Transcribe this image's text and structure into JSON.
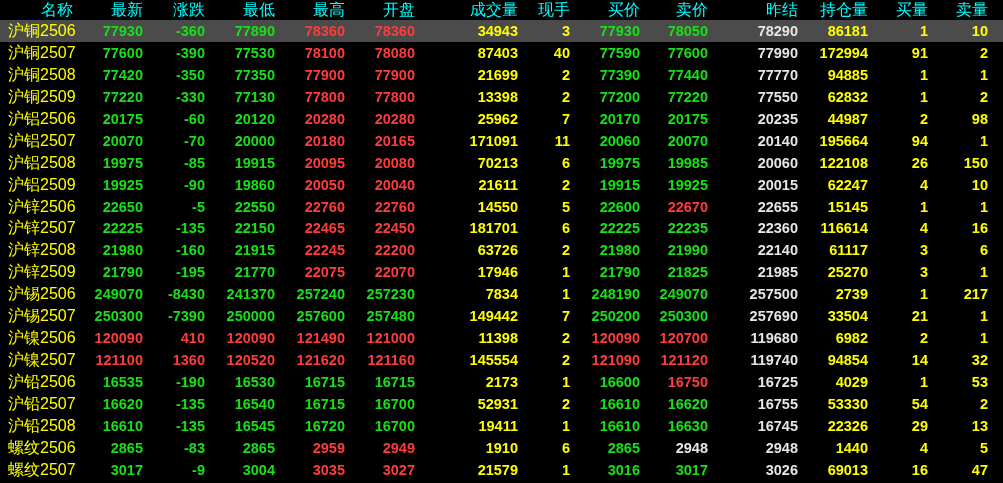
{
  "columns": [
    {
      "label": "名称",
      "kind": "name"
    },
    {
      "label": "最新",
      "kind": "price"
    },
    {
      "label": "涨跌",
      "kind": "price"
    },
    {
      "label": "最低",
      "kind": "price"
    },
    {
      "label": "最高",
      "kind": "price"
    },
    {
      "label": "开盘",
      "kind": "price"
    },
    {
      "label": "成交量",
      "kind": "volume"
    },
    {
      "label": "现手",
      "kind": "volume"
    },
    {
      "label": "买价",
      "kind": "price"
    },
    {
      "label": "卖价",
      "kind": "price"
    },
    {
      "label": "昨结",
      "kind": "settle"
    },
    {
      "label": "持仓量",
      "kind": "volume"
    },
    {
      "label": "买量",
      "kind": "volume"
    },
    {
      "label": "卖量",
      "kind": "volume"
    }
  ],
  "rows": [
    {
      "name": "沪铜2506",
      "selected": true,
      "cells": [
        {
          "text": "77930",
          "color": "#18e018"
        },
        {
          "text": "-360",
          "color": "#18e018"
        },
        {
          "text": "77890",
          "color": "#18e018"
        },
        {
          "text": "78360",
          "color": "#ff3c3c"
        },
        {
          "text": "78360",
          "color": "#ff3c3c"
        },
        {
          "text": "34943"
        },
        {
          "text": "3"
        },
        {
          "text": "77930",
          "color": "#18e018"
        },
        {
          "text": "78050",
          "color": "#18e018"
        },
        {
          "text": "78290"
        },
        {
          "text": "86181"
        },
        {
          "text": "1"
        },
        {
          "text": "10"
        }
      ]
    },
    {
      "name": "沪铜2507",
      "selected": false,
      "cells": [
        {
          "text": "77600",
          "color": "#18e018"
        },
        {
          "text": "-390",
          "color": "#18e018"
        },
        {
          "text": "77530",
          "color": "#18e018"
        },
        {
          "text": "78100",
          "color": "#ff3c3c"
        },
        {
          "text": "78080",
          "color": "#ff3c3c"
        },
        {
          "text": "87403"
        },
        {
          "text": "40"
        },
        {
          "text": "77590",
          "color": "#18e018"
        },
        {
          "text": "77600",
          "color": "#18e018"
        },
        {
          "text": "77990"
        },
        {
          "text": "172994"
        },
        {
          "text": "91"
        },
        {
          "text": "2"
        }
      ]
    },
    {
      "name": "沪铜2508",
      "selected": false,
      "cells": [
        {
          "text": "77420",
          "color": "#18e018"
        },
        {
          "text": "-350",
          "color": "#18e018"
        },
        {
          "text": "77350",
          "color": "#18e018"
        },
        {
          "text": "77900",
          "color": "#ff3c3c"
        },
        {
          "text": "77900",
          "color": "#ff3c3c"
        },
        {
          "text": "21699"
        },
        {
          "text": "2"
        },
        {
          "text": "77390",
          "color": "#18e018"
        },
        {
          "text": "77440",
          "color": "#18e018"
        },
        {
          "text": "77770"
        },
        {
          "text": "94885"
        },
        {
          "text": "1"
        },
        {
          "text": "1"
        }
      ]
    },
    {
      "name": "沪铜2509",
      "selected": false,
      "cells": [
        {
          "text": "77220",
          "color": "#18e018"
        },
        {
          "text": "-330",
          "color": "#18e018"
        },
        {
          "text": "77130",
          "color": "#18e018"
        },
        {
          "text": "77800",
          "color": "#ff3c3c"
        },
        {
          "text": "77800",
          "color": "#ff3c3c"
        },
        {
          "text": "13398"
        },
        {
          "text": "2"
        },
        {
          "text": "77200",
          "color": "#18e018"
        },
        {
          "text": "77220",
          "color": "#18e018"
        },
        {
          "text": "77550"
        },
        {
          "text": "62832"
        },
        {
          "text": "1"
        },
        {
          "text": "2"
        }
      ]
    },
    {
      "name": "沪铝2506",
      "selected": false,
      "cells": [
        {
          "text": "20175",
          "color": "#18e018"
        },
        {
          "text": "-60",
          "color": "#18e018"
        },
        {
          "text": "20120",
          "color": "#18e018"
        },
        {
          "text": "20280",
          "color": "#ff3c3c"
        },
        {
          "text": "20280",
          "color": "#ff3c3c"
        },
        {
          "text": "25962"
        },
        {
          "text": "7"
        },
        {
          "text": "20170",
          "color": "#18e018"
        },
        {
          "text": "20175",
          "color": "#18e018"
        },
        {
          "text": "20235"
        },
        {
          "text": "44987"
        },
        {
          "text": "2"
        },
        {
          "text": "98"
        }
      ]
    },
    {
      "name": "沪铝2507",
      "selected": false,
      "cells": [
        {
          "text": "20070",
          "color": "#18e018"
        },
        {
          "text": "-70",
          "color": "#18e018"
        },
        {
          "text": "20000",
          "color": "#18e018"
        },
        {
          "text": "20180",
          "color": "#ff3c3c"
        },
        {
          "text": "20165",
          "color": "#ff3c3c"
        },
        {
          "text": "171091"
        },
        {
          "text": "11"
        },
        {
          "text": "20060",
          "color": "#18e018"
        },
        {
          "text": "20070",
          "color": "#18e018"
        },
        {
          "text": "20140"
        },
        {
          "text": "195664"
        },
        {
          "text": "94"
        },
        {
          "text": "1"
        }
      ]
    },
    {
      "name": "沪铝2508",
      "selected": false,
      "cells": [
        {
          "text": "19975",
          "color": "#18e018"
        },
        {
          "text": "-85",
          "color": "#18e018"
        },
        {
          "text": "19915",
          "color": "#18e018"
        },
        {
          "text": "20095",
          "color": "#ff3c3c"
        },
        {
          "text": "20080",
          "color": "#ff3c3c"
        },
        {
          "text": "70213"
        },
        {
          "text": "6"
        },
        {
          "text": "19975",
          "color": "#18e018"
        },
        {
          "text": "19985",
          "color": "#18e018"
        },
        {
          "text": "20060"
        },
        {
          "text": "122108"
        },
        {
          "text": "26"
        },
        {
          "text": "150"
        }
      ]
    },
    {
      "name": "沪铝2509",
      "selected": false,
      "cells": [
        {
          "text": "19925",
          "color": "#18e018"
        },
        {
          "text": "-90",
          "color": "#18e018"
        },
        {
          "text": "19860",
          "color": "#18e018"
        },
        {
          "text": "20050",
          "color": "#ff3c3c"
        },
        {
          "text": "20040",
          "color": "#ff3c3c"
        },
        {
          "text": "21611"
        },
        {
          "text": "2"
        },
        {
          "text": "19915",
          "color": "#18e018"
        },
        {
          "text": "19925",
          "color": "#18e018"
        },
        {
          "text": "20015"
        },
        {
          "text": "62247"
        },
        {
          "text": "4"
        },
        {
          "text": "10"
        }
      ]
    },
    {
      "name": "沪锌2506",
      "selected": false,
      "cells": [
        {
          "text": "22650",
          "color": "#18e018"
        },
        {
          "text": "-5",
          "color": "#18e018"
        },
        {
          "text": "22550",
          "color": "#18e018"
        },
        {
          "text": "22760",
          "color": "#ff3c3c"
        },
        {
          "text": "22760",
          "color": "#ff3c3c"
        },
        {
          "text": "14550"
        },
        {
          "text": "5"
        },
        {
          "text": "22600",
          "color": "#18e018"
        },
        {
          "text": "22670",
          "color": "#ff3c3c"
        },
        {
          "text": "22655"
        },
        {
          "text": "15145"
        },
        {
          "text": "1"
        },
        {
          "text": "1"
        }
      ]
    },
    {
      "name": "沪锌2507",
      "selected": false,
      "cells": [
        {
          "text": "22225",
          "color": "#18e018"
        },
        {
          "text": "-135",
          "color": "#18e018"
        },
        {
          "text": "22150",
          "color": "#18e018"
        },
        {
          "text": "22465",
          "color": "#ff3c3c"
        },
        {
          "text": "22450",
          "color": "#ff3c3c"
        },
        {
          "text": "181701"
        },
        {
          "text": "6"
        },
        {
          "text": "22225",
          "color": "#18e018"
        },
        {
          "text": "22235",
          "color": "#18e018"
        },
        {
          "text": "22360"
        },
        {
          "text": "116614"
        },
        {
          "text": "4"
        },
        {
          "text": "16"
        }
      ]
    },
    {
      "name": "沪锌2508",
      "selected": false,
      "cells": [
        {
          "text": "21980",
          "color": "#18e018"
        },
        {
          "text": "-160",
          "color": "#18e018"
        },
        {
          "text": "21915",
          "color": "#18e018"
        },
        {
          "text": "22245",
          "color": "#ff3c3c"
        },
        {
          "text": "22200",
          "color": "#ff3c3c"
        },
        {
          "text": "63726"
        },
        {
          "text": "2"
        },
        {
          "text": "21980",
          "color": "#18e018"
        },
        {
          "text": "21990",
          "color": "#18e018"
        },
        {
          "text": "22140"
        },
        {
          "text": "61117"
        },
        {
          "text": "3"
        },
        {
          "text": "6"
        }
      ]
    },
    {
      "name": "沪锌2509",
      "selected": false,
      "cells": [
        {
          "text": "21790",
          "color": "#18e018"
        },
        {
          "text": "-195",
          "color": "#18e018"
        },
        {
          "text": "21770",
          "color": "#18e018"
        },
        {
          "text": "22075",
          "color": "#ff3c3c"
        },
        {
          "text": "22070",
          "color": "#ff3c3c"
        },
        {
          "text": "17946"
        },
        {
          "text": "1"
        },
        {
          "text": "21790",
          "color": "#18e018"
        },
        {
          "text": "21825",
          "color": "#18e018"
        },
        {
          "text": "21985"
        },
        {
          "text": "25270"
        },
        {
          "text": "3"
        },
        {
          "text": "1"
        }
      ]
    },
    {
      "name": "沪锡2506",
      "selected": false,
      "cells": [
        {
          "text": "249070",
          "color": "#18e018"
        },
        {
          "text": "-8430",
          "color": "#18e018"
        },
        {
          "text": "241370",
          "color": "#18e018"
        },
        {
          "text": "257240",
          "color": "#18e018"
        },
        {
          "text": "257230",
          "color": "#18e018"
        },
        {
          "text": "7834"
        },
        {
          "text": "1"
        },
        {
          "text": "248190",
          "color": "#18e018"
        },
        {
          "text": "249070",
          "color": "#18e018"
        },
        {
          "text": "257500"
        },
        {
          "text": "2739"
        },
        {
          "text": "1"
        },
        {
          "text": "217"
        }
      ]
    },
    {
      "name": "沪锡2507",
      "selected": false,
      "cells": [
        {
          "text": "250300",
          "color": "#18e018"
        },
        {
          "text": "-7390",
          "color": "#18e018"
        },
        {
          "text": "250000",
          "color": "#18e018"
        },
        {
          "text": "257600",
          "color": "#18e018"
        },
        {
          "text": "257480",
          "color": "#18e018"
        },
        {
          "text": "149442"
        },
        {
          "text": "7"
        },
        {
          "text": "250200",
          "color": "#18e018"
        },
        {
          "text": "250300",
          "color": "#18e018"
        },
        {
          "text": "257690"
        },
        {
          "text": "33504"
        },
        {
          "text": "21"
        },
        {
          "text": "1"
        }
      ]
    },
    {
      "name": "沪镍2506",
      "selected": false,
      "cells": [
        {
          "text": "120090",
          "color": "#ff3c3c"
        },
        {
          "text": "410",
          "color": "#ff3c3c"
        },
        {
          "text": "120090",
          "color": "#ff3c3c"
        },
        {
          "text": "121490",
          "color": "#ff3c3c"
        },
        {
          "text": "121000",
          "color": "#ff3c3c"
        },
        {
          "text": "11398"
        },
        {
          "text": "2"
        },
        {
          "text": "120090",
          "color": "#ff3c3c"
        },
        {
          "text": "120700",
          "color": "#ff3c3c"
        },
        {
          "text": "119680"
        },
        {
          "text": "6982"
        },
        {
          "text": "2"
        },
        {
          "text": "1"
        }
      ]
    },
    {
      "name": "沪镍2507",
      "selected": false,
      "cells": [
        {
          "text": "121100",
          "color": "#ff3c3c"
        },
        {
          "text": "1360",
          "color": "#ff3c3c"
        },
        {
          "text": "120520",
          "color": "#ff3c3c"
        },
        {
          "text": "121620",
          "color": "#ff3c3c"
        },
        {
          "text": "121160",
          "color": "#ff3c3c"
        },
        {
          "text": "145554"
        },
        {
          "text": "2"
        },
        {
          "text": "121090",
          "color": "#ff3c3c"
        },
        {
          "text": "121120",
          "color": "#ff3c3c"
        },
        {
          "text": "119740"
        },
        {
          "text": "94854"
        },
        {
          "text": "14"
        },
        {
          "text": "32"
        }
      ]
    },
    {
      "name": "沪铅2506",
      "selected": false,
      "cells": [
        {
          "text": "16535",
          "color": "#18e018"
        },
        {
          "text": "-190",
          "color": "#18e018"
        },
        {
          "text": "16530",
          "color": "#18e018"
        },
        {
          "text": "16715",
          "color": "#18e018"
        },
        {
          "text": "16715",
          "color": "#18e018"
        },
        {
          "text": "2173"
        },
        {
          "text": "1"
        },
        {
          "text": "16600",
          "color": "#18e018"
        },
        {
          "text": "16750",
          "color": "#ff3c3c"
        },
        {
          "text": "16725"
        },
        {
          "text": "4029"
        },
        {
          "text": "1"
        },
        {
          "text": "53"
        }
      ]
    },
    {
      "name": "沪铅2507",
      "selected": false,
      "cells": [
        {
          "text": "16620",
          "color": "#18e018"
        },
        {
          "text": "-135",
          "color": "#18e018"
        },
        {
          "text": "16540",
          "color": "#18e018"
        },
        {
          "text": "16715",
          "color": "#18e018"
        },
        {
          "text": "16700",
          "color": "#18e018"
        },
        {
          "text": "52931"
        },
        {
          "text": "2"
        },
        {
          "text": "16610",
          "color": "#18e018"
        },
        {
          "text": "16620",
          "color": "#18e018"
        },
        {
          "text": "16755"
        },
        {
          "text": "53330"
        },
        {
          "text": "54"
        },
        {
          "text": "2"
        }
      ]
    },
    {
      "name": "沪铅2508",
      "selected": false,
      "cells": [
        {
          "text": "16610",
          "color": "#18e018"
        },
        {
          "text": "-135",
          "color": "#18e018"
        },
        {
          "text": "16545",
          "color": "#18e018"
        },
        {
          "text": "16720",
          "color": "#18e018"
        },
        {
          "text": "16700",
          "color": "#18e018"
        },
        {
          "text": "19411"
        },
        {
          "text": "1"
        },
        {
          "text": "16610",
          "color": "#18e018"
        },
        {
          "text": "16630",
          "color": "#18e018"
        },
        {
          "text": "16745"
        },
        {
          "text": "22326"
        },
        {
          "text": "29"
        },
        {
          "text": "13"
        }
      ]
    },
    {
      "name": "螺纹2506",
      "selected": false,
      "cells": [
        {
          "text": "2865",
          "color": "#18e018"
        },
        {
          "text": "-83",
          "color": "#18e018"
        },
        {
          "text": "2865",
          "color": "#18e018"
        },
        {
          "text": "2959",
          "color": "#ff3c3c"
        },
        {
          "text": "2949",
          "color": "#ff3c3c"
        },
        {
          "text": "1910"
        },
        {
          "text": "6"
        },
        {
          "text": "2865",
          "color": "#18e018"
        },
        {
          "text": "2948",
          "color": "#e6e6e6"
        },
        {
          "text": "2948"
        },
        {
          "text": "1440"
        },
        {
          "text": "4"
        },
        {
          "text": "5"
        }
      ]
    },
    {
      "name": "螺纹2507",
      "selected": false,
      "cells": [
        {
          "text": "3017",
          "color": "#18e018"
        },
        {
          "text": "-9",
          "color": "#18e018"
        },
        {
          "text": "3004",
          "color": "#18e018"
        },
        {
          "text": "3035",
          "color": "#ff3c3c"
        },
        {
          "text": "3027",
          "color": "#ff3c3c"
        },
        {
          "text": "21579"
        },
        {
          "text": "1"
        },
        {
          "text": "3016",
          "color": "#18e018"
        },
        {
          "text": "3017",
          "color": "#18e018"
        },
        {
          "text": "3026"
        },
        {
          "text": "69013"
        },
        {
          "text": "16"
        },
        {
          "text": "47"
        }
      ]
    }
  ]
}
